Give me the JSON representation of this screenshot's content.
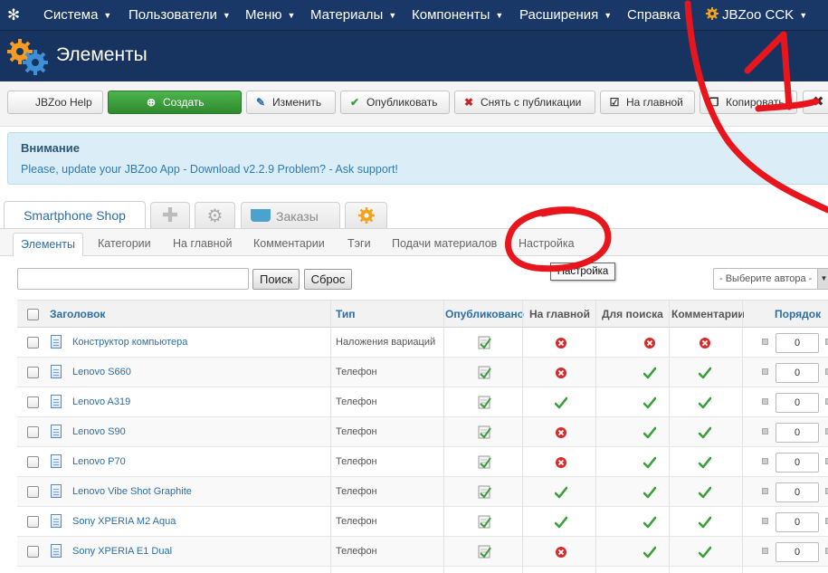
{
  "topnav": {
    "items": [
      {
        "label": "Система"
      },
      {
        "label": "Пользователи"
      },
      {
        "label": "Меню"
      },
      {
        "label": "Материалы"
      },
      {
        "label": "Компоненты"
      },
      {
        "label": "Расширения"
      },
      {
        "label": "Справка"
      },
      {
        "label": "JBZoo CCK"
      }
    ]
  },
  "header": {
    "title": "Элементы"
  },
  "toolbar": {
    "help": "JBZoo Help",
    "create": "Создать",
    "edit": "Изменить",
    "publish": "Опубликовать",
    "unpublish": "Снять с публикации",
    "frontpage": "На главной",
    "copy": "Копировать"
  },
  "alert": {
    "title": "Внимание",
    "text": "Please, update your JBZoo App - Download v2.2.9   Problem? - Ask support!"
  },
  "apptabs": {
    "active": "Smartphone Shop",
    "orders": "Заказы"
  },
  "subtabs": {
    "items": [
      {
        "label": "Элементы"
      },
      {
        "label": "Категории"
      },
      {
        "label": "На главной"
      },
      {
        "label": "Комментарии"
      },
      {
        "label": "Тэги"
      },
      {
        "label": "Подачи материалов"
      },
      {
        "label": "Настройка"
      }
    ]
  },
  "filter": {
    "search_button": "Поиск",
    "reset_button": "Сброс",
    "author_placeholder": "- Выберите автора -",
    "tooltip": "Настройка"
  },
  "table": {
    "headers": {
      "title": "Заголовок",
      "type": "Тип",
      "published": "Опубликовано",
      "frontpage": "На главной",
      "searchable": "Для поиска",
      "comments": "Комментарии",
      "order": "Порядок"
    },
    "rows": [
      {
        "name": "Конструктор компьютера",
        "type": "Наложения вариаций",
        "frontpage": "no",
        "search": "no",
        "comments": "no",
        "order": "0"
      },
      {
        "name": "Lenovo S660",
        "type": "Телефон",
        "frontpage": "no",
        "search": "yes",
        "comments": "yes",
        "order": "0"
      },
      {
        "name": "Lenovo A319",
        "type": "Телефон",
        "frontpage": "yes",
        "search": "yes",
        "comments": "yes",
        "order": "0"
      },
      {
        "name": "Lenovo S90",
        "type": "Телефон",
        "frontpage": "no",
        "search": "yes",
        "comments": "yes",
        "order": "0"
      },
      {
        "name": "Lenovo P70",
        "type": "Телефон",
        "frontpage": "no",
        "search": "yes",
        "comments": "yes",
        "order": "0"
      },
      {
        "name": "Lenovo Vibe Shot Graphite",
        "type": "Телефон",
        "frontpage": "yes",
        "search": "yes",
        "comments": "yes",
        "order": "0"
      },
      {
        "name": "Sony XPERIA M2 Aqua",
        "type": "Телефон",
        "frontpage": "yes",
        "search": "yes",
        "comments": "yes",
        "order": "0"
      },
      {
        "name": "Sony XPERIA E1 Dual",
        "type": "Телефон",
        "frontpage": "no",
        "search": "yes",
        "comments": "yes",
        "order": "0"
      }
    ]
  },
  "colors": {
    "nav_bg": "#1a3867",
    "header_bg": "#17335f",
    "link": "#2b6ea8",
    "green": "#39a039",
    "red": "#d62b2b",
    "annotation_red": "#e8161c"
  }
}
